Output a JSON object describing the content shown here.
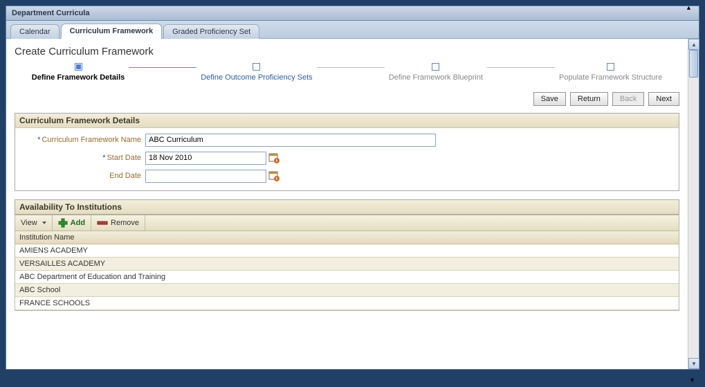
{
  "window": {
    "title": "Department Curricula"
  },
  "tabs": [
    {
      "label": "Calendar"
    },
    {
      "label": "Curriculum Framework"
    },
    {
      "label": "Graded Proficiency Set"
    }
  ],
  "page": {
    "title": "Create Curriculum Framework"
  },
  "wizard": {
    "steps": [
      {
        "label": "Define Framework Details"
      },
      {
        "label": "Define Outcome Proficiency Sets"
      },
      {
        "label": "Define Framework Blueprint"
      },
      {
        "label": "Populate Framework Structure"
      }
    ]
  },
  "buttons": {
    "save": "Save",
    "return": "Return",
    "back": "Back",
    "next": "Next"
  },
  "details_panel": {
    "header": "Curriculum Framework Details",
    "name_label": "Curriculum Framework Name",
    "start_label": "Start Date",
    "end_label": "End Date",
    "name_value": "ABC Curriculum",
    "start_value": "18 Nov 2010",
    "end_value": ""
  },
  "availability_panel": {
    "header": "Availability To Institutions",
    "toolbar": {
      "view": "View",
      "add": "Add",
      "remove": "Remove"
    },
    "column_header": "Institution Name",
    "rows": [
      "AMIENS ACADEMY",
      "VERSAILLES ACADEMY",
      "ABC Department of Education and Training",
      "ABC School",
      "FRANCE SCHOOLS"
    ]
  }
}
